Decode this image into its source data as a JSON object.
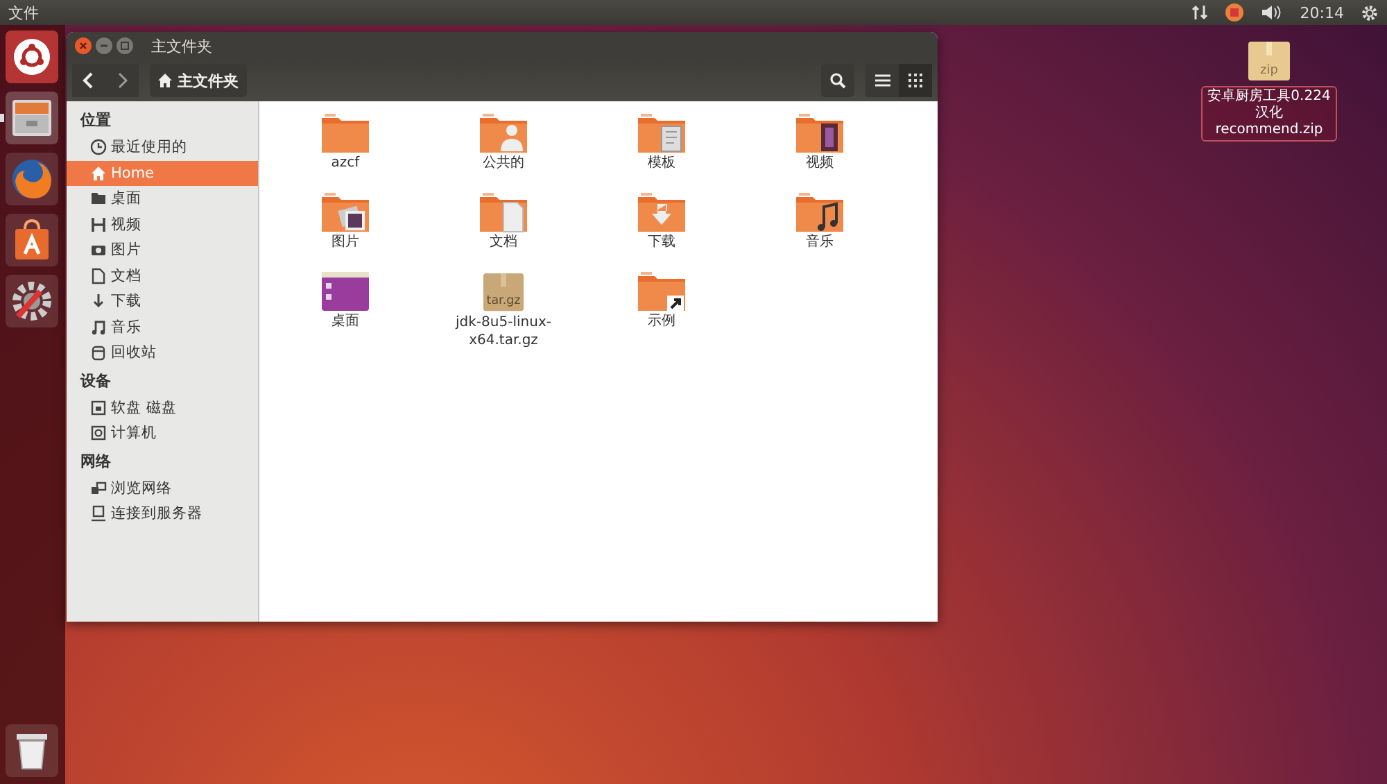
{
  "top_bar": {
    "app_name": "文件",
    "clock": "20:14",
    "indicators": [
      {
        "kind": "network"
      },
      {
        "kind": "update"
      },
      {
        "kind": "volume"
      }
    ]
  },
  "launcher": {
    "items": [
      {
        "kind": "dash",
        "running": false
      },
      {
        "kind": "files",
        "running": true
      },
      {
        "kind": "browser",
        "running": false
      },
      {
        "kind": "store",
        "running": false
      },
      {
        "kind": "settings",
        "running": false
      }
    ],
    "trash": {
      "kind": "trash"
    }
  },
  "window": {
    "title": "主文件夹",
    "path_button": "主文件夹",
    "view_buttons": [
      {
        "kind": "list",
        "selected": false
      },
      {
        "kind": "grid",
        "selected": true
      }
    ],
    "sidebar": [
      {
        "heading": "位置",
        "items": [
          {
            "kind": "recent",
            "label": "最近使用的",
            "selected": false
          },
          {
            "kind": "home",
            "label": "Home",
            "selected": true
          },
          {
            "kind": "desktop",
            "label": "桌面",
            "selected": false
          },
          {
            "kind": "videos",
            "label": "视频",
            "selected": false
          },
          {
            "kind": "pictures",
            "label": "图片",
            "selected": false
          },
          {
            "kind": "documents",
            "label": "文档",
            "selected": false
          },
          {
            "kind": "downloads",
            "label": "下载",
            "selected": false
          },
          {
            "kind": "music",
            "label": "音乐",
            "selected": false
          },
          {
            "kind": "trash",
            "label": "回收站",
            "selected": false
          }
        ]
      },
      {
        "heading": "设备",
        "items": [
          {
            "kind": "drive",
            "label": "软盘 磁盘",
            "selected": false
          },
          {
            "kind": "computer",
            "label": "计算机",
            "selected": false
          }
        ]
      },
      {
        "heading": "网络",
        "items": [
          {
            "kind": "network",
            "label": "浏览网络",
            "selected": false
          },
          {
            "kind": "server",
            "label": "连接到服务器",
            "selected": false
          }
        ]
      }
    ],
    "files": [
      {
        "kind": "folder",
        "label": "azcf"
      },
      {
        "kind": "public",
        "label": "公共的"
      },
      {
        "kind": "templates",
        "label": "模板"
      },
      {
        "kind": "videos",
        "label": "视频"
      },
      {
        "kind": "pictures",
        "label": "图片"
      },
      {
        "kind": "documents",
        "label": "文档"
      },
      {
        "kind": "downloads",
        "label": "下载"
      },
      {
        "kind": "music",
        "label": "音乐"
      },
      {
        "kind": "desktop",
        "label": "桌面"
      },
      {
        "kind": "archive",
        "label": "jdk-8u5-linux-x64.tar.gz",
        "badge": "tar.gz"
      },
      {
        "kind": "link",
        "label": "示例"
      }
    ]
  },
  "desktop_icon": {
    "label": "安卓厨房工具0.224汉化 recommend.zip",
    "badge": "zip",
    "selected": true
  }
}
